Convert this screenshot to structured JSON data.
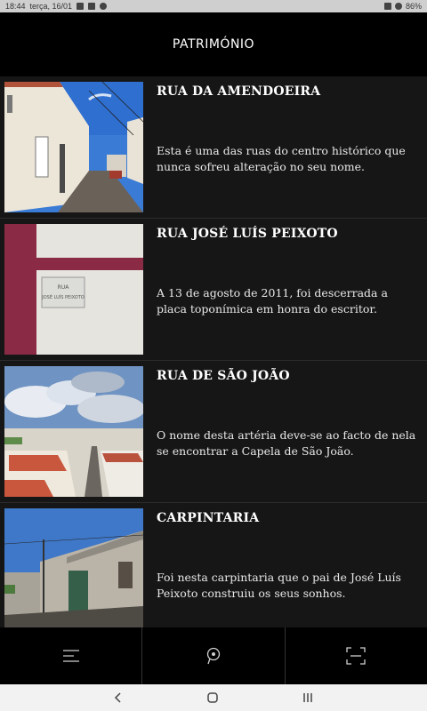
{
  "status_bar": {
    "time": "18:44",
    "date": "terça, 16/01",
    "battery": "86%"
  },
  "header": {
    "title": "PATRIMÓNIO"
  },
  "items": [
    {
      "title": "RUA DA AMENDOEIRA",
      "description": "Esta é uma das ruas do centro histórico que nunca sofreu alteração no seu nome."
    },
    {
      "title": "RUA JOSÉ LUÍS PEIXOTO",
      "description": "A 13 de agosto de 2011, foi descerrada a placa toponímica em honra do escritor.",
      "plaque": [
        "RUA",
        "JOSÉ LUÍS PEIXOTO"
      ]
    },
    {
      "title": "RUA DE SÃO JOÃO",
      "description": "O nome desta artéria deve-se ao facto de nela se encontrar a Capela de São João."
    },
    {
      "title": "CARPINTARIA",
      "description": "Foi nesta carpintaria que o pai de José Luís Peixoto construiu os seus sonhos."
    }
  ],
  "bottom_nav": [
    {
      "icon": "menu-icon"
    },
    {
      "icon": "map-pin-icon"
    },
    {
      "icon": "scan-icon"
    }
  ],
  "system_nav": [
    {
      "icon": "back-icon"
    },
    {
      "icon": "home-icon"
    },
    {
      "icon": "recents-icon"
    }
  ]
}
